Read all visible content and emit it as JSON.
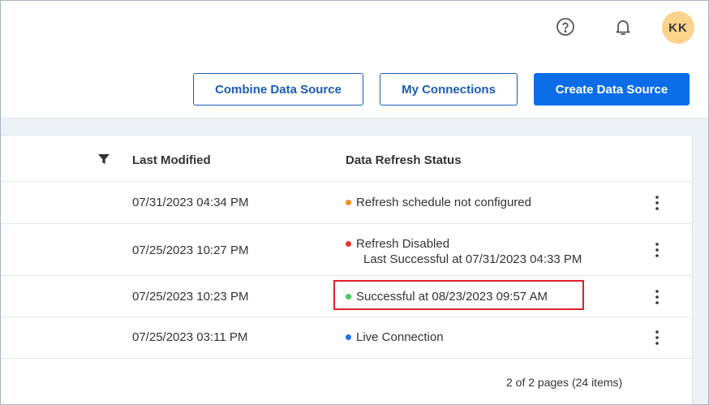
{
  "header": {
    "help_icon": "help-circle-icon",
    "bell_icon": "bell-icon",
    "avatar_initials": "KK",
    "avatar_color": "#fbd38d"
  },
  "actions": {
    "combine_label": "Combine Data Source",
    "my_connections_label": "My Connections",
    "create_label": "Create Data Source",
    "accent_color": "#0b6ee8"
  },
  "table": {
    "columns": {
      "last_modified": "Last Modified",
      "refresh_status": "Data Refresh Status"
    },
    "filter_icon": "filter-icon",
    "rows": [
      {
        "last_modified": "07/31/2023 04:34 PM",
        "status": "Refresh schedule not configured",
        "status_color": "#f5901e",
        "sub": ""
      },
      {
        "last_modified": "07/25/2023 10:27 PM",
        "status": "Refresh Disabled",
        "status_color": "#e8322d",
        "sub": "Last Successful at 07/31/2023 04:33 PM"
      },
      {
        "last_modified": "07/25/2023 10:23 PM",
        "status": "Successful at 08/23/2023 09:57 AM",
        "status_color": "#3fcf5a",
        "sub": ""
      },
      {
        "last_modified": "07/25/2023 03:11 PM",
        "status": "Live Connection",
        "status_color": "#1a73e8",
        "sub": ""
      }
    ],
    "pagination": "2 of 2 pages (24 items)"
  }
}
